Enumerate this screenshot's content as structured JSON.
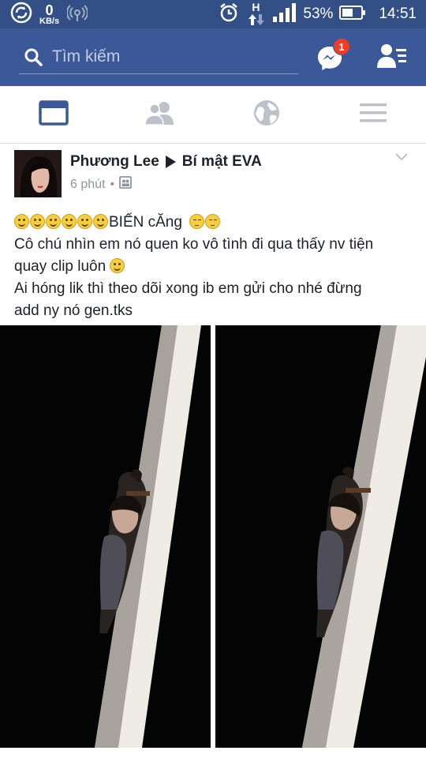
{
  "status_bar": {
    "speed_value": "0",
    "speed_unit": "KB/s",
    "network_type": "H",
    "battery": "53%",
    "time": "14:51",
    "icons": [
      "sync-icon",
      "wifi-hotspot-icon",
      "alarm-icon",
      "data-arrows-icon",
      "signal-icon",
      "battery-icon"
    ]
  },
  "header": {
    "search_placeholder": "Tìm kiếm",
    "messenger_badge": "1",
    "colors": {
      "brand": "#3b5998",
      "status_bar": "#324f86",
      "badge": "#f03d25"
    }
  },
  "tabs": [
    {
      "name": "news-feed",
      "icon": "news-feed-icon",
      "active": true
    },
    {
      "name": "friends",
      "icon": "friends-icon",
      "active": false
    },
    {
      "name": "notifications",
      "icon": "globe-icon",
      "active": false
    },
    {
      "name": "menu",
      "icon": "menu-icon",
      "active": false
    }
  ],
  "post": {
    "author": "Phương Lee",
    "group": "Bí mật EVA",
    "time": "6 phút",
    "separator": "•",
    "audience_icon": "group-icon",
    "lines": {
      "line1_text": "BIẾN cĂng",
      "line2": "Cô chú nhìn em nó quen ko vô tình đi qua thấy nv  tiện",
      "line3_text": "quay clip luôn",
      "line4": "Ai hóng lik thì theo dõi xong ib em gửi cho nhé đừng",
      "line5": "add ny nó gen.tks"
    },
    "photos_count": 2
  }
}
